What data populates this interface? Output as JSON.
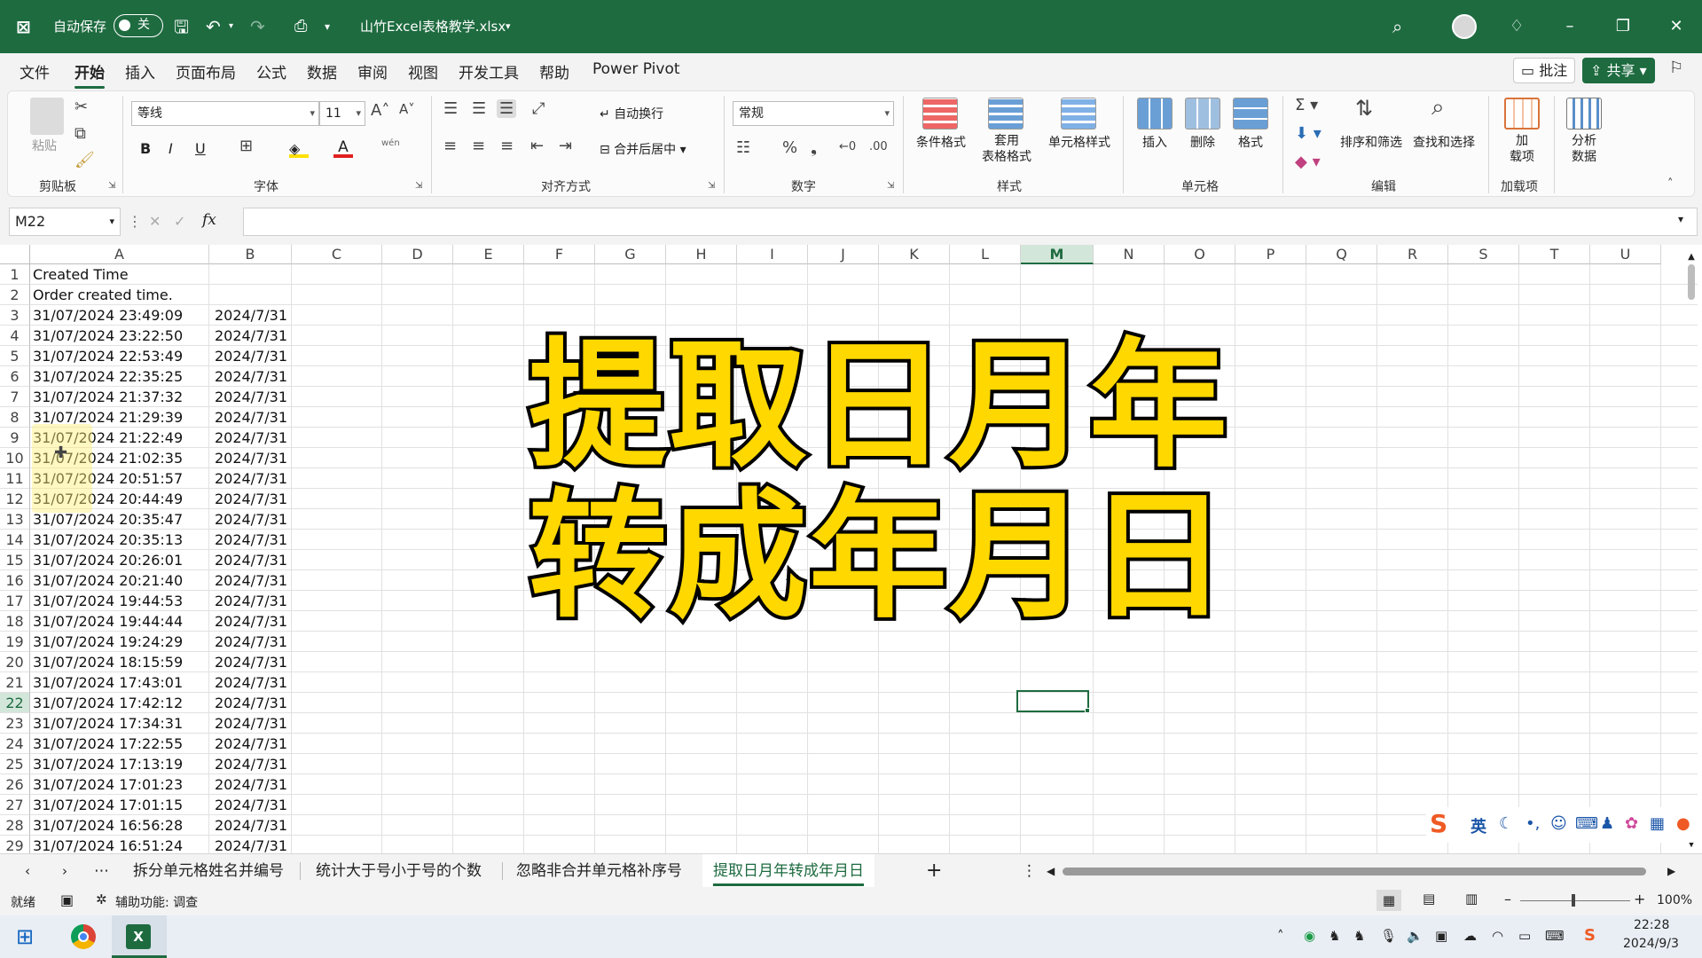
{
  "titlebar": {
    "autosave_label": "自动保存",
    "autosave_state": "关",
    "filename": "山竹Excel表格教学.xlsx"
  },
  "menu": {
    "items": [
      "文件",
      "开始",
      "插入",
      "页面布局",
      "公式",
      "数据",
      "审阅",
      "视图",
      "开发工具",
      "帮助",
      "Power Pivot"
    ],
    "active": "开始",
    "comment_button": "批注",
    "share_button": "共享"
  },
  "ribbon": {
    "clipboard": {
      "paste": "粘贴",
      "group": "剪贴板"
    },
    "font": {
      "name": "等线",
      "size": "11",
      "group": "字体",
      "bold": "B",
      "italic": "I",
      "underline": "U",
      "phonetic": "wén"
    },
    "alignment": {
      "wrap": "自动换行",
      "merge": "合并后居中",
      "group": "对齐方式"
    },
    "number": {
      "format": "常规",
      "group": "数字"
    },
    "styles": {
      "conditional": "条件格式",
      "table": "套用\n表格格式",
      "cell_styles": "单元格样式",
      "group": "样式"
    },
    "cells": {
      "insert": "插入",
      "delete": "删除",
      "format": "格式",
      "group": "单元格"
    },
    "editing": {
      "sort": "排序和筛选",
      "find": "查找和选择",
      "group": "编辑"
    },
    "addins": {
      "addins": "加\n载项",
      "group": "加载项"
    },
    "analyze": {
      "label": "分析\n数据"
    }
  },
  "formula_bar": {
    "name_box": "M22",
    "fx": "fx",
    "value": ""
  },
  "columns": [
    "A",
    "B",
    "C",
    "D",
    "E",
    "F",
    "G",
    "H",
    "I",
    "J",
    "K",
    "L",
    "M",
    "N",
    "O",
    "P",
    "Q",
    "R",
    "S",
    "T",
    "U"
  ],
  "selected_column": "M",
  "selected_row": "22",
  "rows": [
    {
      "n": "1",
      "a": "Created Time",
      "b": ""
    },
    {
      "n": "2",
      "a": "Order created time.",
      "b": ""
    },
    {
      "n": "3",
      "a": "31/07/2024 23:49:09",
      "b": "2024/7/31"
    },
    {
      "n": "4",
      "a": "31/07/2024 23:22:50",
      "b": "2024/7/31"
    },
    {
      "n": "5",
      "a": "31/07/2024 22:53:49",
      "b": "2024/7/31"
    },
    {
      "n": "6",
      "a": "31/07/2024 22:35:25",
      "b": "2024/7/31"
    },
    {
      "n": "7",
      "a": "31/07/2024 21:37:32",
      "b": "2024/7/31"
    },
    {
      "n": "8",
      "a": "31/07/2024 21:29:39",
      "b": "2024/7/31"
    },
    {
      "n": "9",
      "a": "31/07/2024 21:22:49",
      "b": "2024/7/31"
    },
    {
      "n": "10",
      "a": "31/07/2024 21:02:35",
      "b": "2024/7/31"
    },
    {
      "n": "11",
      "a": "31/07/2024 20:51:57",
      "b": "2024/7/31"
    },
    {
      "n": "12",
      "a": "31/07/2024 20:44:49",
      "b": "2024/7/31"
    },
    {
      "n": "13",
      "a": "31/07/2024 20:35:47",
      "b": "2024/7/31"
    },
    {
      "n": "14",
      "a": "31/07/2024 20:35:13",
      "b": "2024/7/31"
    },
    {
      "n": "15",
      "a": "31/07/2024 20:26:01",
      "b": "2024/7/31"
    },
    {
      "n": "16",
      "a": "31/07/2024 20:21:40",
      "b": "2024/7/31"
    },
    {
      "n": "17",
      "a": "31/07/2024 19:44:53",
      "b": "2024/7/31"
    },
    {
      "n": "18",
      "a": "31/07/2024 19:44:44",
      "b": "2024/7/31"
    },
    {
      "n": "19",
      "a": "31/07/2024 19:24:29",
      "b": "2024/7/31"
    },
    {
      "n": "20",
      "a": "31/07/2024 18:15:59",
      "b": "2024/7/31"
    },
    {
      "n": "21",
      "a": "31/07/2024 17:43:01",
      "b": "2024/7/31"
    },
    {
      "n": "22",
      "a": "31/07/2024 17:42:12",
      "b": "2024/7/31"
    },
    {
      "n": "23",
      "a": "31/07/2024 17:34:31",
      "b": "2024/7/31"
    },
    {
      "n": "24",
      "a": "31/07/2024 17:22:55",
      "b": "2024/7/31"
    },
    {
      "n": "25",
      "a": "31/07/2024 17:13:19",
      "b": "2024/7/31"
    },
    {
      "n": "26",
      "a": "31/07/2024 17:01:23",
      "b": "2024/7/31"
    },
    {
      "n": "27",
      "a": "31/07/2024 17:01:15",
      "b": "2024/7/31"
    },
    {
      "n": "28",
      "a": "31/07/2024 16:56:28",
      "b": "2024/7/31"
    },
    {
      "n": "29",
      "a": "31/07/2024 16:51:24",
      "b": "2024/7/31"
    }
  ],
  "overlay": {
    "line1": "提取日月年",
    "line2": "转成年月日"
  },
  "sheets": [
    "拆分单元格姓名并编号",
    "统计大于号小于号的个数",
    "忽略非合并单元格补序号",
    "提取日月年转成年月日"
  ],
  "active_sheet": "提取日月年转成年月日",
  "status": {
    "ready": "就绪",
    "accessibility": "辅助功能: 调查",
    "zoom": "100%"
  },
  "ime": {
    "lang": "英"
  },
  "taskbar": {
    "time": "22:28",
    "date": "2024/9/3"
  },
  "colors": {
    "excel_green": "#1e6b40",
    "overlay_fill": "#ffd800",
    "overlay_stroke": "#000000"
  }
}
